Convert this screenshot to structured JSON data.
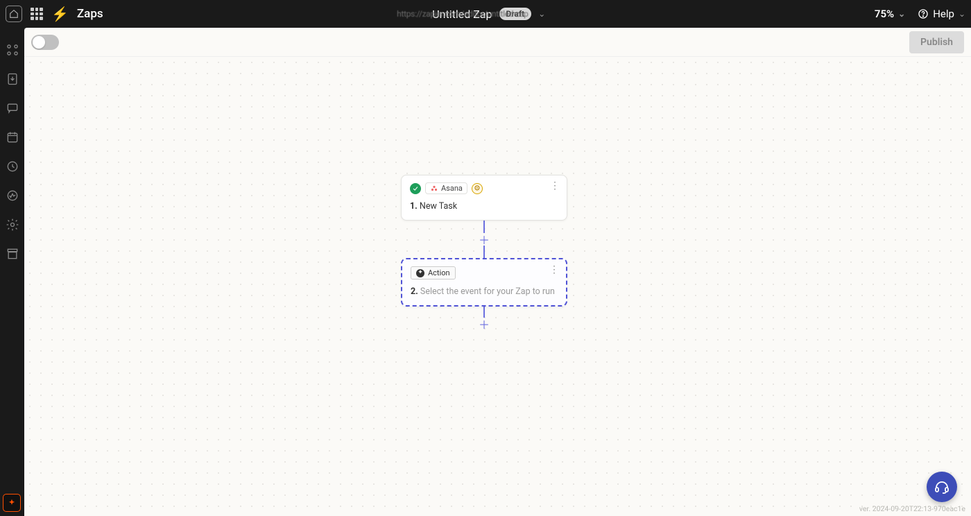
{
  "header": {
    "breadcrumb": "Zaps",
    "zap_title": "Untitled Zap",
    "draft_label": "Draft",
    "zoom_label": "75%",
    "help_label": "Help",
    "url_ghost": "https://zapier.com/editor/untitled-zap"
  },
  "toolbar": {
    "publish_label": "Publish"
  },
  "flow": {
    "step1": {
      "number": "1.",
      "app_name": "Asana",
      "title": "New Task"
    },
    "step2": {
      "number": "2.",
      "chip_label": "Action",
      "placeholder": "Select the event for your Zap to run"
    }
  },
  "footer": {
    "version_text": "ver. 2024-09-20T22:13-970eac1e"
  }
}
